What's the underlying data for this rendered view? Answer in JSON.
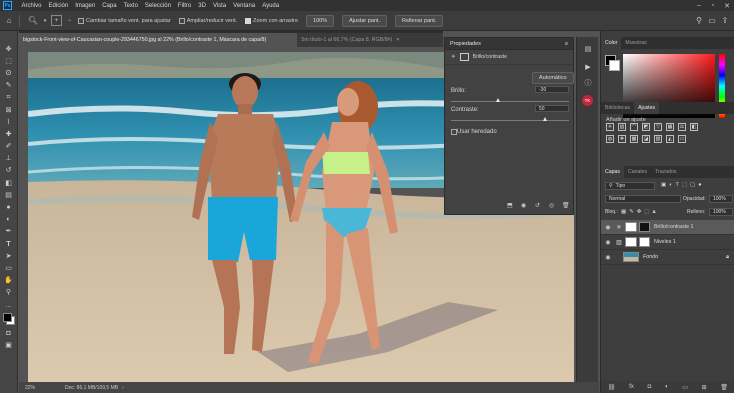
{
  "app": {
    "logo": "Ps",
    "menu": [
      "Archivo",
      "Edición",
      "Imagen",
      "Capa",
      "Texto",
      "Selección",
      "Filtro",
      "3D",
      "Vista",
      "Ventana",
      "Ayuda"
    ]
  },
  "options_bar": {
    "scroll_all": "Cambiar tamaño vent. para ajustar",
    "fit_screen_windows": "Ampliar/reducir vent.",
    "scrubby_zoom": "Zoom con arrastre",
    "zoom_100": "100%",
    "fit_screen": "Ajustar pant.",
    "fill_screen": "Rellenar pant."
  },
  "doc_tabs": {
    "active": "bigstock-Front-view-of-Caucasian-couple-293446750.jpg al 22% (Brillo/contraste 1, Máscara de capa/8)",
    "inactive": "Sin título-1 al 66,7% (Capa 8, RGB/8#)"
  },
  "status": {
    "zoom": "22%",
    "doc": "Doc: 86,1 MB/109,5 MB"
  },
  "properties": {
    "title": "Propiedades",
    "subtitle": "Brillo/contraste",
    "auto_button": "Automático",
    "brightness_label": "Brillo:",
    "brightness_value": "-30",
    "brightness_fraction": 0.4,
    "contrast_label": "Contraste:",
    "contrast_value": "50",
    "contrast_fraction": 0.8,
    "legacy_label": "Usar heredado"
  },
  "color_panel": {
    "tabs": [
      "Color",
      "Muestras"
    ],
    "foreground": "#000000",
    "background": "#ffffff"
  },
  "adjust_panel": {
    "tabs": [
      "Bibliotecas",
      "Ajustes"
    ],
    "heading": "Añadir un ajuste"
  },
  "layers_panel": {
    "tabs": [
      "Capas",
      "Canales",
      "Trazados"
    ],
    "filter": "Tipo",
    "blend_mode": "Normal",
    "opacity_label": "Opacidad:",
    "opacity_value": "100%",
    "lock_label": "Bloq.:",
    "fill_label": "Relleno:",
    "fill_value": "100%",
    "layers": [
      {
        "name": "Brillo/contraste 1"
      },
      {
        "name": "Niveles 1"
      },
      {
        "name": "Fondo"
      }
    ]
  },
  "colors": {
    "accent": "#31a8ff",
    "panel": "#3e3e3e",
    "workspace": "#535353"
  }
}
